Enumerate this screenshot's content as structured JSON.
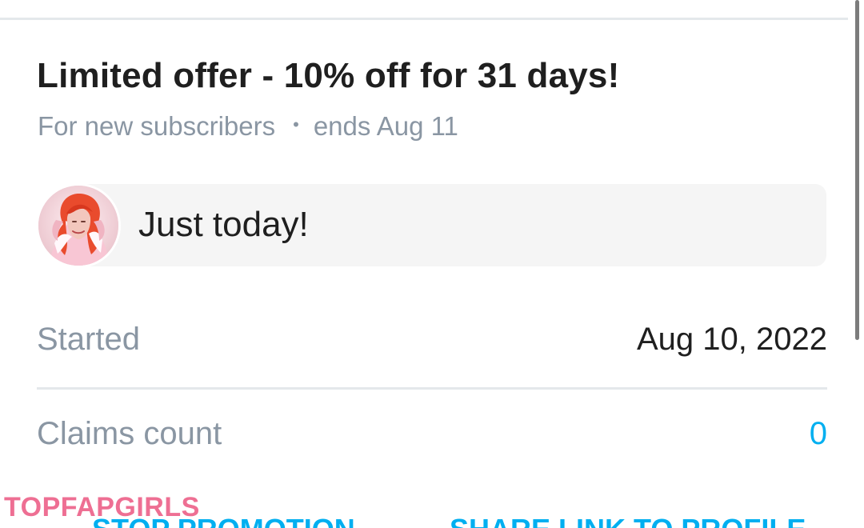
{
  "offer": {
    "title": "Limited offer - 10% off for 31 days!",
    "audience": "For new subscribers",
    "separator": "•",
    "ends": "ends Aug 11"
  },
  "message": {
    "text": "Just today!",
    "avatar_icon": "creator-avatar-image"
  },
  "details": {
    "started_label": "Started",
    "started_value": "Aug 10, 2022",
    "claims_label": "Claims count",
    "claims_value": "0"
  },
  "actions": {
    "stop_label": "STOP PROMOTION",
    "share_label": "SHARE LINK TO PROFILE"
  },
  "watermark": {
    "text": "TOPFAPGIRLS"
  },
  "colors": {
    "accent": "#00aff0",
    "muted_text": "#8a96a3",
    "primary_text": "#1f1f1f",
    "divider": "#e4e8eb",
    "bubble_background": "#f5f5f5",
    "watermark": "#ee6f93"
  }
}
